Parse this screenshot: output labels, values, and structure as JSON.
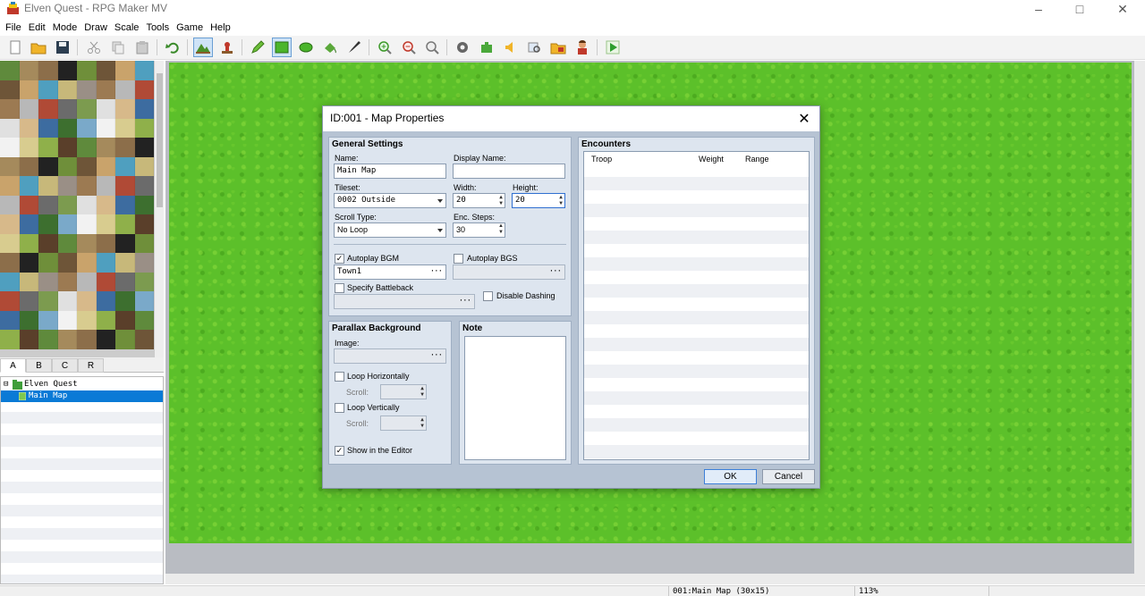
{
  "window": {
    "title": "Elven Quest - RPG Maker MV",
    "minimize_icon": "minimize-icon",
    "maximize_icon": "maximize-icon",
    "close_icon": "close-icon"
  },
  "menu": [
    "File",
    "Edit",
    "Mode",
    "Draw",
    "Scale",
    "Tools",
    "Game",
    "Help"
  ],
  "toolbar": {
    "buttons": [
      "new-project-icon",
      "open-project-icon",
      "save-project-icon",
      "cut-icon",
      "copy-icon",
      "paste-icon",
      "undo-icon",
      "map-mode-icon",
      "event-mode-icon",
      "pencil-icon",
      "rectangle-icon",
      "ellipse-icon",
      "flood-fill-icon",
      "shadow-pen-icon",
      "zoom-in-icon",
      "zoom-out-icon",
      "actual-size-icon",
      "database-icon",
      "plugin-manager-icon",
      "sound-test-icon",
      "event-searcher-icon",
      "resource-manager-icon",
      "character-generator-icon",
      "playtest-icon"
    ],
    "active": [
      "map-mode-icon",
      "rectangle-icon"
    ]
  },
  "palette_tabs": [
    "A",
    "B",
    "C",
    "R"
  ],
  "map_tree": {
    "root": "Elven Quest",
    "maps": [
      "Main Map"
    ]
  },
  "status": {
    "map_info": "001:Main Map (30x15)",
    "zoom": "113%"
  },
  "dialog": {
    "title": "ID:001 - Map Properties",
    "general": {
      "section_title": "General Settings",
      "name_label": "Name:",
      "name_value": "Main Map",
      "display_name_label": "Display Name:",
      "display_name_value": "",
      "tileset_label": "Tileset:",
      "tileset_value": "0002 Outside",
      "width_label": "Width:",
      "width_value": "20",
      "height_label": "Height:",
      "height_value": "20",
      "scroll_type_label": "Scroll Type:",
      "scroll_type_value": "No Loop",
      "enc_steps_label": "Enc. Steps:",
      "enc_steps_value": "30",
      "autoplay_bgm_label": "Autoplay BGM",
      "autoplay_bgm_checked": true,
      "bgm_value": "Town1",
      "autoplay_bgs_label": "Autoplay BGS",
      "autoplay_bgs_checked": false,
      "bgs_value": "",
      "specify_battleback_label": "Specify Battleback",
      "specify_battleback_checked": false,
      "battleback_value": "",
      "disable_dashing_label": "Disable Dashing",
      "disable_dashing_checked": false
    },
    "parallax": {
      "section_title": "Parallax Background",
      "image_label": "Image:",
      "image_value": "",
      "loop_h_label": "Loop Horizontally",
      "loop_h_checked": false,
      "scroll_h_label": "Scroll:",
      "scroll_h_value": "",
      "loop_v_label": "Loop Vertically",
      "loop_v_checked": false,
      "scroll_v_label": "Scroll:",
      "scroll_v_value": "",
      "show_in_editor_label": "Show in the Editor",
      "show_in_editor_checked": true
    },
    "note": {
      "section_title": "Note",
      "value": ""
    },
    "encounters": {
      "section_title": "Encounters",
      "columns": [
        "Troop",
        "Weight",
        "Range"
      ],
      "rows": []
    },
    "ok_label": "OK",
    "cancel_label": "Cancel"
  }
}
